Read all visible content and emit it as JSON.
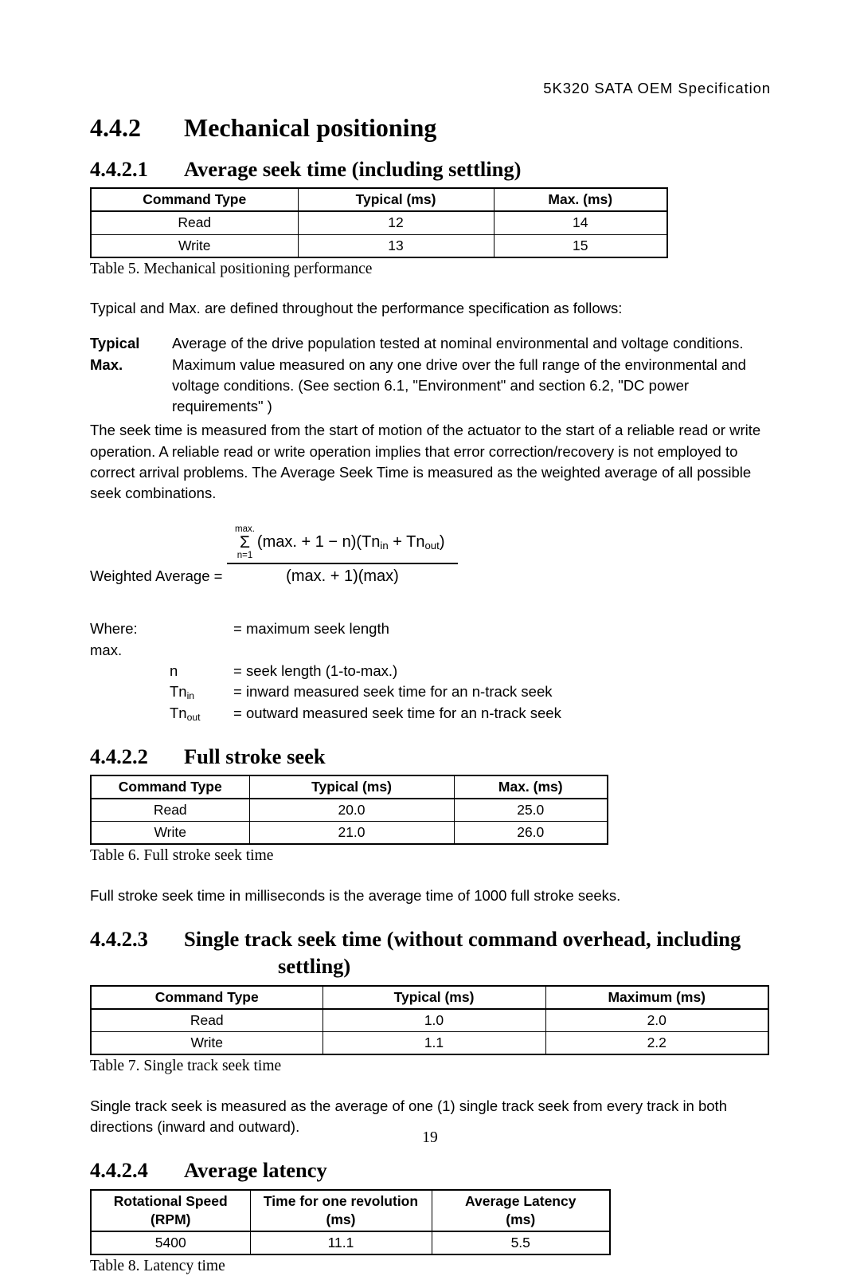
{
  "header": {
    "running_title": "5K320 SATA OEM Specification"
  },
  "sections": {
    "s442": {
      "number": "4.4.2",
      "title": "Mechanical positioning"
    },
    "s4421": {
      "number": "4.4.2.1",
      "title": "Average seek time (including settling)"
    },
    "s4422": {
      "number": "4.4.2.2",
      "title": "Full stroke seek"
    },
    "s4423": {
      "number": "4.4.2.3",
      "title_line1": "Single track seek time (without command overhead, including",
      "title_line2": "settling)"
    },
    "s4424": {
      "number": "4.4.2.4",
      "title": "Average latency"
    }
  },
  "table5": {
    "caption": "Table 5. Mechanical positioning performance",
    "headers": [
      "Command Type",
      "Typical (ms)",
      "Max. (ms)"
    ],
    "rows": [
      [
        "Read",
        "12",
        "14"
      ],
      [
        "Write",
        "13",
        "15"
      ]
    ]
  },
  "table6": {
    "caption": "Table 6. Full stroke seek time",
    "headers": [
      "Command Type",
      "Typical (ms)",
      "Max. (ms)"
    ],
    "rows": [
      [
        "Read",
        "20.0",
        "25.0"
      ],
      [
        "Write",
        "21.0",
        "26.0"
      ]
    ]
  },
  "table7": {
    "caption": "Table 7. Single track seek time",
    "headers": [
      "Command Type",
      "Typical (ms)",
      "Maximum (ms)"
    ],
    "rows": [
      [
        "Read",
        "1.0",
        "2.0"
      ],
      [
        "Write",
        "1.1",
        "2.2"
      ]
    ]
  },
  "table8": {
    "caption": "Table 8. Latency time",
    "headers_line1": [
      "Rotational Speed",
      "Time for one revolution",
      "Average Latency"
    ],
    "headers_line2": [
      "(RPM)",
      "(ms)",
      "(ms)"
    ],
    "rows": [
      [
        "5400",
        "11.1",
        "5.5"
      ]
    ]
  },
  "body": {
    "defs_intro": "Typical and Max. are defined throughout the performance specification as follows:",
    "def_typical_term": "Typical",
    "def_typical_desc": "Average of the drive population tested at nominal environmental and voltage conditions.",
    "def_max_term": "Max.",
    "def_max_desc_line1": "Maximum value measured on any one drive over the full range of the environmental and",
    "def_max_desc_line2": "voltage   conditions. (See section 6.1, \"Environment\" and section 6.2, \"DC power",
    "def_max_desc_line3": "requirements\" )",
    "seek_time_paragraph": "The seek time is measured from the start of motion of the actuator to the start of a reliable read or write operation. A reliable read or write operation implies that error correction/recovery is not employed to correct arrival problems. The Average Seek Time is measured as the weighted average of all possible seek combinations.",
    "full_stroke_paragraph": "Full stroke seek time in milliseconds is the average time of 1000 full stroke seeks.",
    "single_track_paragraph": "Single track seek is measured as the average of one (1) single track seek from every track in both directions (inward and outward)."
  },
  "formula": {
    "label": "Weighted Average =",
    "sigma_upper": "max.",
    "sigma_symbol": "Σ",
    "sigma_lower": "n=1",
    "numerator_expr": "(max. + 1 − n)(Tn",
    "numerator_sub1": "in",
    "numerator_mid": " + Tn",
    "numerator_sub2": "out",
    "numerator_end": ")",
    "denominator": "(max. + 1)(max)"
  },
  "where": {
    "lead": "Where: max.",
    "max_def": "= maximum seek length",
    "n_sym": "n",
    "n_def": "= seek length (1-to-max.)",
    "tn_in_sym": "Tn",
    "tn_in_sub": "in",
    "tn_in_def": "= inward measured seek time for an n-track seek",
    "tn_out_sym": "Tn",
    "tn_out_sub": "out",
    "tn_out_def": "= outward measured seek time for an n-track seek"
  },
  "footer": {
    "page_number": "19"
  }
}
